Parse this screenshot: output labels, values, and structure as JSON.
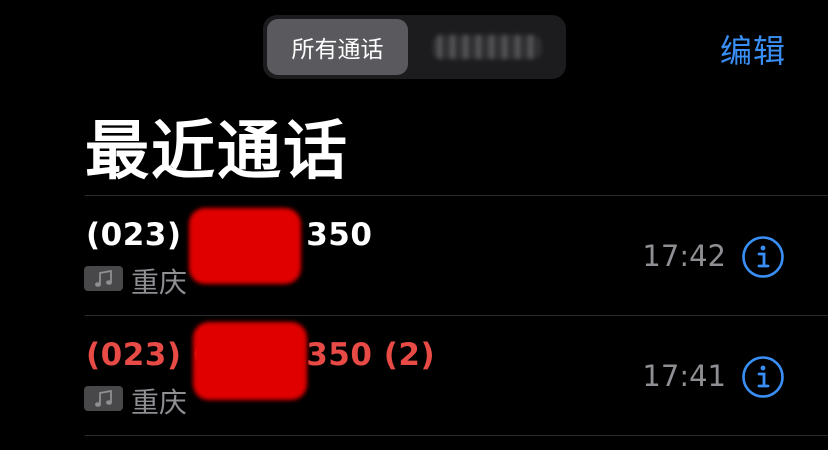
{
  "segmented": {
    "all_label": "所有通话"
  },
  "header": {
    "edit_label": "编辑",
    "title": "最近通话"
  },
  "calls": [
    {
      "number": "(023) 6      350",
      "location": "重庆",
      "time": "17:42",
      "missed": false
    },
    {
      "number": "(023) 6      350 (2)",
      "location": "重庆",
      "time": "17:41",
      "missed": true
    }
  ],
  "colors": {
    "accent": "#3a8ff6",
    "missed": "#e84b46",
    "secondary": "#8e8e93",
    "background": "#000000"
  },
  "icons": {
    "call_type": "music-note-icon",
    "details": "info-circle-icon"
  }
}
